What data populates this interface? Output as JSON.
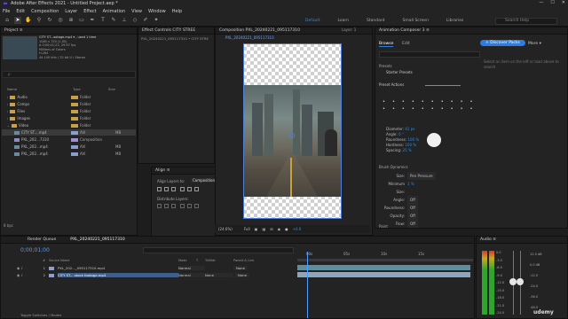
{
  "window": {
    "title": "Adobe After Effects 2021 - Untitled Project.aep *",
    "controls": [
      "—",
      "☐",
      "✕"
    ]
  },
  "menu": [
    "File",
    "Edit",
    "Composition",
    "Layer",
    "Effect",
    "Animation",
    "View",
    "Window",
    "Help"
  ],
  "workspaces": [
    "Default",
    "Learn",
    "Standard",
    "Small Screen",
    "Libraries"
  ],
  "help_search": "Search Help",
  "project": {
    "tab": "Project ≡",
    "selected_name": "CITY ST...ootage.mp4 ▾ , used 1 time",
    "meta": [
      "1080 x 720 (1.00)",
      "Δ 0;00;41;23, 29.97 fps",
      "Millions of Colors",
      "H.264",
      "44.100 kHz / 32 bit U / Stereo"
    ],
    "search_placeholder": "ρ",
    "columns": [
      "Name",
      "Type",
      "Size"
    ],
    "rows": [
      {
        "name": "Audio",
        "type": "Folder",
        "size": "",
        "indent": 1,
        "kind": "folder"
      },
      {
        "name": "Comps",
        "type": "Folder",
        "size": "",
        "indent": 1,
        "kind": "folder"
      },
      {
        "name": "Files",
        "type": "Folder",
        "size": "",
        "indent": 1,
        "kind": "folder"
      },
      {
        "name": "Images",
        "type": "Folder",
        "size": "",
        "indent": 1,
        "kind": "folder"
      },
      {
        "name": "Video",
        "type": "Folder",
        "size": "",
        "indent": 1,
        "kind": "folder"
      },
      {
        "name": "CITY ST....mp4",
        "type": "AVI",
        "size": "MB",
        "indent": 2,
        "kind": "file",
        "selected": true
      },
      {
        "name": "PXL_202...7310",
        "type": "Composition",
        "size": "",
        "indent": 2,
        "kind": "comp"
      },
      {
        "name": "PXL_202...mp4",
        "type": "AVI",
        "size": "MB",
        "indent": 2,
        "kind": "file"
      },
      {
        "name": "PXL_202...mp4",
        "type": "AVI",
        "size": "MB",
        "indent": 2,
        "kind": "file"
      }
    ],
    "footer": "8 bpc"
  },
  "effect_controls": {
    "tab": "Effect Controls CITY STREE",
    "crumb": "PXL_20240221_095117310 • CITY STRE"
  },
  "composition": {
    "tab": "Composition PXL_20240221_095117310",
    "comp_tab": "PXL_20240221_095117310",
    "layer_tab": "Layer: 1",
    "zoom": "(24.6%)",
    "res": "Full",
    "time": "+0.0"
  },
  "align": {
    "tab": "Align ≡",
    "align_to_label": "Align Layers to:",
    "align_to_value": "Composition",
    "distribute_label": "Distribute Layers:"
  },
  "animation_composer": {
    "tab": "Animation Composer 3 ≡",
    "subtabs": [
      "Browse",
      "Edit"
    ],
    "discover_btn": "+ Discover Packs",
    "more": "More ▾",
    "presets_label": "Presets",
    "starter": "Starter Presets",
    "empty_msg": "Select an item on the left or load above to search",
    "preset_actions": "Preset Actions",
    "brush_fields": [
      {
        "label": "Diameter:",
        "value": "41 px"
      },
      {
        "label": "Angle:",
        "value": "0 °"
      },
      {
        "label": "Roundness:",
        "value": "100 %"
      },
      {
        "label": "Hardness:",
        "value": "100 %"
      },
      {
        "label": "Spacing:",
        "value": "25 %"
      }
    ],
    "brush_dynamics": "Brush Dynamics",
    "dynamics": [
      {
        "label": "Size:",
        "value": "Pen Pressure"
      },
      {
        "label": "Minimum Size:",
        "value": "1 %"
      },
      {
        "label": "Angle:",
        "value": "Off"
      },
      {
        "label": "Roundness:",
        "value": "Off"
      },
      {
        "label": "Opacity:",
        "value": "Off"
      },
      {
        "label": "Flow:",
        "value": "Off"
      }
    ],
    "paint": "Paint"
  },
  "timeline": {
    "tabs": [
      "Render Queue",
      "PXL_20240221_095117310"
    ],
    "timecode": "0;00;01;00",
    "ruler": [
      "00s",
      "05s",
      "10s",
      "15s"
    ],
    "col_headers": [
      "#",
      "Source Name",
      "Mode",
      "T",
      "TrkMat",
      "Parent & Link"
    ],
    "layers": [
      {
        "num": "1",
        "name": "PXL_202..._095117310.mp4",
        "mode": "Normal",
        "trkmat": "",
        "parent": "None"
      },
      {
        "num": "2",
        "name": "CITY ST... stock footage.mp4",
        "mode": "Normal",
        "trkmat": "None",
        "parent": "None"
      }
    ],
    "footer": "Toggle Switches / Modes"
  },
  "audio": {
    "tab": "Audio ≡",
    "scale": [
      "0.0",
      "-3.0",
      "-6.0",
      "-9.0",
      "-12.0",
      "-15.0",
      "-18.0",
      "-21.0",
      "-24.0"
    ],
    "db": [
      "12.0 dB",
      "0.0 dB",
      "-12.0",
      "-24.0",
      "-36.0",
      "-48.0"
    ],
    "watermark": "udemy"
  }
}
